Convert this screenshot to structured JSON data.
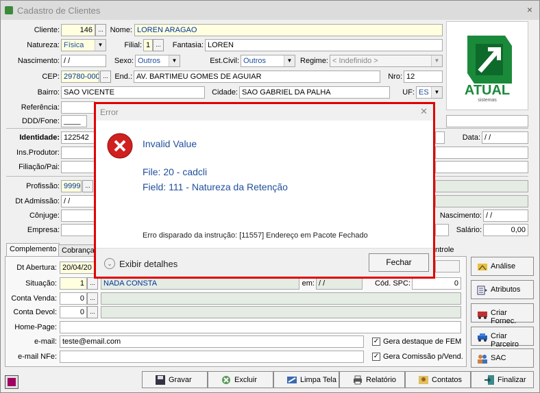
{
  "window": {
    "title": "Cadastro de Clientes",
    "close": "×"
  },
  "form": {
    "cliente_label": "Cliente:",
    "cliente": "146",
    "nome_label": "Nome:",
    "nome": "LOREN ARAGAO",
    "natureza_label": "Natureza:",
    "natureza": "Física",
    "filial_label": "Filial:",
    "filial": "1",
    "fantasia_label": "Fantasia:",
    "fantasia": "LOREN",
    "nascimento_label": "Nascimento:",
    "nascimento": " / /",
    "sexo_label": "Sexo:",
    "sexo": "Outros",
    "estcivil_label": "Est.Civil:",
    "estcivil": "Outros",
    "regime_label": "Regime:",
    "regime": "< Indefinido >",
    "cep_label": "CEP:",
    "cep": "29780-000",
    "end_label": "End.:",
    "endereco": "AV. BARTIMEU GOMES DE AGUIAR",
    "nro_label": "Nro:",
    "nro": "12",
    "bairro_label": "Bairro:",
    "bairro": "SAO VICENTE",
    "cidade_label": "Cidade:",
    "cidade": "SAO GABRIEL DA PALHA",
    "uf_label": "UF:",
    "uf": "ES",
    "referencia_label": "Referência:",
    "dddfone_label": "DDD/Fone:",
    "dddfone": "____",
    "identidade_label": "Identidade:",
    "identidade": "122542",
    "data_label": "Data:",
    "data": " / /",
    "insprodutor_label": "Ins.Produtor:",
    "filiacao_label": "Filiação/Pai:",
    "profissao_label": "Profissão:",
    "profissao": "9999",
    "dtadmissao_label": "Dt Admissão:",
    "dtadmissao": " / /",
    "conjuge_label": "Cônjuge:",
    "empresa_label": "Empresa:",
    "nascimento2_label": "Nascimento:",
    "nascimento2": " / /",
    "salario_label": "Salário:",
    "salario": "0,00"
  },
  "tabs": [
    "Complemento",
    "Cobrança",
    "ntrole"
  ],
  "complemento": {
    "dtabertura_label": "Dt Abertura:",
    "dtabertura": "20/04/20",
    "situacao_label": "Situação:",
    "situacao": "1",
    "situacao_desc": "NADA CONSTA",
    "em_label": "em:",
    "em": " / /",
    "codspc_label": "Cód. SPC:",
    "codspc": "0",
    "contavenda_label": "Conta Venda:",
    "contavenda": "0",
    "contadevol_label": "Conta Devol:",
    "contadevol": "0",
    "homepage_label": "Home-Page:",
    "email_label": "e-mail:",
    "email": "teste@email.com",
    "emailnfe_label": "e-mail NFe:",
    "chk1": "Gera destaque de FEM",
    "chk2": "Gera Comissão p/Vend."
  },
  "side_buttons": [
    "Análise",
    "Atributos",
    "Criar Fornec.",
    "Criar Parceiro",
    "SAC"
  ],
  "bottom_buttons": [
    "Gravar",
    "Excluir",
    "Limpa Tela",
    "Relatório",
    "Contatos",
    "Finalizar"
  ],
  "logo": {
    "name": "ATUAL",
    "sub": "sistemas",
    "color": "#1a8a3a"
  },
  "dialog": {
    "title": "Error",
    "heading": "Invalid Value",
    "file": "File: 20 - cadcli",
    "field": "Field: 111 - Natureza da Retenção",
    "instr": "Erro disparado da instrução: [11557] Endereço em Pacote Fechado",
    "details": "Exibir detalhes",
    "ok": "Fechar"
  },
  "colors": {
    "accent": "#1f4e9c",
    "error_border": "#e00000",
    "error_icon": "#d02020"
  }
}
